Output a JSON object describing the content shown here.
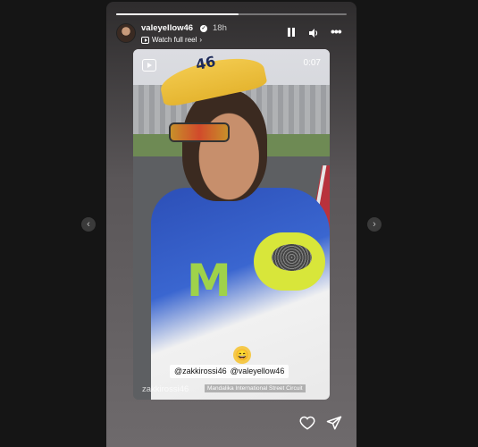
{
  "story": {
    "username": "valeyellow46",
    "time": "18h",
    "reel_link": "Watch full reel",
    "duration": "0:07",
    "progress": 0.53
  },
  "overlay": {
    "tags": [
      "@zakkirossi46",
      "@valeyellow46"
    ],
    "location": "Mandalika International Street Circuit",
    "watermark": "zakkirossi46",
    "cap_number": "46"
  },
  "nav": {
    "prev_icon": "chevron-left-icon",
    "next_icon": "chevron-right-icon"
  },
  "colors": {
    "background": "#151515",
    "cap": "#f2c94c",
    "suit_blue": "#2c4fb7",
    "suit_yellow": "#d8e63a"
  }
}
